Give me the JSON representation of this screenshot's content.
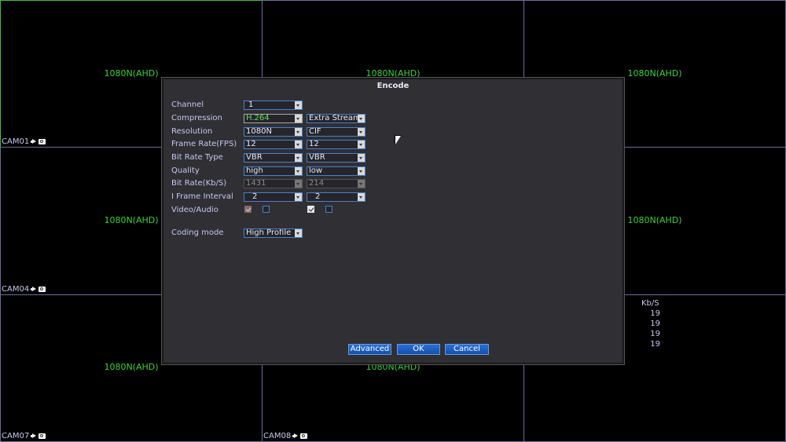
{
  "grid": {
    "cells": [
      {
        "resolution": "1080N(AHD)",
        "cam": "CAM01"
      },
      {
        "resolution": "1080N(AHD)",
        "cam": ""
      },
      {
        "resolution": "1080N(AHD)",
        "cam": ""
      },
      {
        "resolution": "1080N(AHD)",
        "cam": "CAM04"
      },
      {
        "resolution": "",
        "cam": ""
      },
      {
        "resolution": "1080N(AHD)",
        "cam": ""
      },
      {
        "resolution": "1080N(AHD)",
        "cam": "CAM07"
      },
      {
        "resolution": "1080N(AHD)",
        "cam": "CAM08"
      },
      {
        "resolution": "",
        "cam": ""
      }
    ]
  },
  "stats": {
    "header": "Kb/S",
    "values": [
      "19",
      "19",
      "19",
      "19"
    ]
  },
  "dialog": {
    "title": "Encode",
    "rows": {
      "channel": {
        "label": "Channel",
        "main": "1"
      },
      "compression": {
        "label": "Compression",
        "main": "H.264",
        "extra": "Extra Stream"
      },
      "resolution": {
        "label": "Resolution",
        "main": "1080N",
        "extra": "CIF"
      },
      "frame_rate": {
        "label": "Frame Rate(FPS)",
        "main": "12",
        "extra": "12"
      },
      "bit_rate_type": {
        "label": "Bit Rate Type",
        "main": "VBR",
        "extra": "VBR"
      },
      "quality": {
        "label": "Quality",
        "main": "high",
        "extra": "low"
      },
      "bit_rate": {
        "label": "Bit Rate(Kb/S)",
        "main": "1431",
        "extra": "214"
      },
      "i_frame": {
        "label": "I Frame Interval",
        "main": "2",
        "extra": "2"
      },
      "video_audio": {
        "label": "Video/Audio",
        "main_video": true,
        "main_audio": false,
        "extra_video": true,
        "extra_audio": false
      },
      "coding_mode": {
        "label": "Coding mode",
        "main": "High Profile"
      }
    },
    "buttons": {
      "advanced": "Advanced",
      "ok": "OK",
      "cancel": "Cancel"
    }
  },
  "colors": {
    "overlay_text": "#3cd23c",
    "accent": "#2a6fd6"
  }
}
